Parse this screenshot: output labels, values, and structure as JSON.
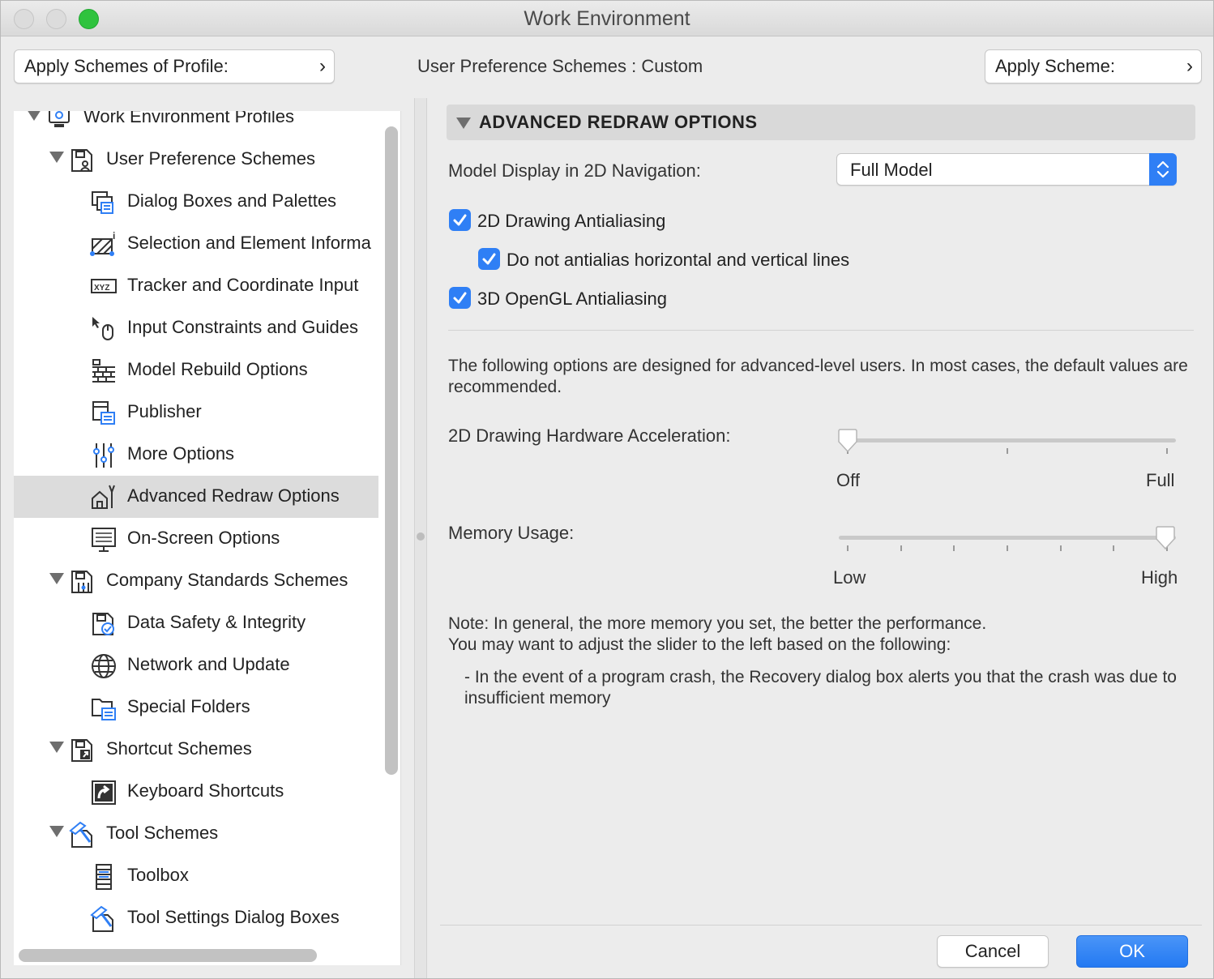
{
  "window": {
    "title": "Work Environment"
  },
  "toolbar": {
    "apply_profile_label": "Apply Schemes of Profile:",
    "scheme_caption": "User Preference Schemes : ",
    "scheme_value": "Custom",
    "apply_scheme_label": "Apply Scheme:",
    "chevron": "›"
  },
  "tree": {
    "items": [
      {
        "label": "Work Environment Profiles",
        "icon": "profiles-icon",
        "level": 0,
        "expanded": true
      },
      {
        "label": "User Preference Schemes",
        "icon": "user-scheme-icon",
        "level": 1,
        "expanded": true
      },
      {
        "label": "Dialog Boxes and Palettes",
        "icon": "dialog-palettes-icon",
        "level": 2
      },
      {
        "label": "Selection and Element Informa",
        "icon": "selection-info-icon",
        "level": 2
      },
      {
        "label": "Tracker and Coordinate Input",
        "icon": "xyz-tracker-icon",
        "level": 2
      },
      {
        "label": "Input Constraints and Guides",
        "icon": "mouse-cursor-icon",
        "level": 2
      },
      {
        "label": "Model Rebuild Options",
        "icon": "brick-wall-icon",
        "level": 2
      },
      {
        "label": "Publisher",
        "icon": "publisher-icon",
        "level": 2
      },
      {
        "label": "More Options",
        "icon": "sliders-icon",
        "level": 2
      },
      {
        "label": "Advanced Redraw Options",
        "icon": "house-redraw-icon",
        "level": 2,
        "selected": true
      },
      {
        "label": "On-Screen Options",
        "icon": "monitor-icon",
        "level": 2
      },
      {
        "label": "Company Standards Schemes",
        "icon": "company-scheme-icon",
        "level": 1,
        "expanded": true
      },
      {
        "label": "Data Safety & Integrity",
        "icon": "data-safety-icon",
        "level": 2
      },
      {
        "label": "Network and Update",
        "icon": "globe-icon",
        "level": 2
      },
      {
        "label": "Special Folders",
        "icon": "folder-icon",
        "level": 2
      },
      {
        "label": "Shortcut Schemes",
        "icon": "shortcut-scheme-icon",
        "level": 1,
        "expanded": true
      },
      {
        "label": "Keyboard Shortcuts",
        "icon": "keyboard-shortcut-icon",
        "level": 2
      },
      {
        "label": "Tool Schemes",
        "icon": "tool-scheme-icon",
        "level": 1,
        "expanded": true
      },
      {
        "label": "Toolbox",
        "icon": "toolbox-icon",
        "level": 2
      },
      {
        "label": "Tool Settings Dialog Boxes",
        "icon": "tool-settings-icon",
        "level": 2
      }
    ]
  },
  "panel": {
    "section_title": "ADVANCED REDRAW OPTIONS",
    "model_display_label": "Model Display in 2D Navigation:",
    "model_display_value": "Full Model",
    "cb_2d_aa": {
      "label": "2D Drawing Antialiasing",
      "checked": true
    },
    "cb_no_hv": {
      "label": "Do not antialias horizontal and vertical lines",
      "checked": true
    },
    "cb_3d_aa": {
      "label": "3D OpenGL Antialiasing",
      "checked": true
    },
    "advanced_note": "The following options are designed for advanced-level users. In most cases, the default values are recommended.",
    "hw_accel": {
      "label": "2D Drawing Hardware Acceleration:",
      "min_label": "Off",
      "max_label": "Full",
      "value": 0,
      "ticks": 3
    },
    "memory": {
      "label": "Memory Usage:",
      "min_label": "Low",
      "max_label": "High",
      "value": 1,
      "ticks": 7
    },
    "note_line1": "Note: In general, the more memory you set, the better the performance.",
    "note_line2": "You may want to adjust the slider to the left based on the following:",
    "note_bullet": "- In the event of a program crash, the Recovery dialog box alerts you that the crash was due to insufficient memory"
  },
  "buttons": {
    "cancel": "Cancel",
    "ok": "OK"
  },
  "colors": {
    "accent": "#2f7ff5",
    "selection": "#dcdcdc"
  }
}
